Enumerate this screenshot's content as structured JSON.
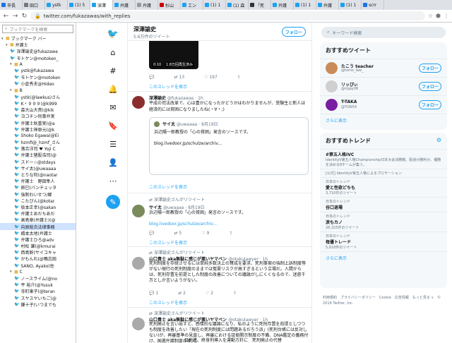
{
  "tabs": [
    {
      "label": "市長",
      "color": "#1a73e8"
    },
    {
      "label": "田口",
      "color": "#777"
    },
    {
      "label": "ystk",
      "color": "#1da1f2"
    },
    {
      "label": "(1) 5",
      "color": "#1da1f2"
    },
    {
      "label": "深澤",
      "color": "#1da1f2"
    },
    {
      "label": "弁護",
      "color": "#1da1f2"
    },
    {
      "label": "弁護",
      "color": "#999"
    },
    {
      "label": "杉山",
      "color": "#c00"
    },
    {
      "label": "エン",
      "color": "#1da1f2"
    },
    {
      "label": "(1) 1",
      "color": "#1da1f2"
    },
    {
      "label": "(1) 森",
      "color": "#1da1f2"
    },
    {
      "label": "「死",
      "color": "#333"
    },
    {
      "label": "弁護",
      "color": "#1da1f2"
    },
    {
      "label": "(1) 1",
      "color": "#1da1f2"
    },
    {
      "label": "弁護",
      "color": "#1da1f2"
    },
    {
      "label": "(1) 1",
      "color": "#1da1f2"
    },
    {
      "label": "scrr",
      "color": "#1a73e8"
    }
  ],
  "browser": {
    "url": "twitter.com/fukazawas/with_replies"
  },
  "sidebar": {
    "search_placeholder": "ブックマークを検索",
    "items": [
      {
        "label": "ブックマーク バー",
        "type": "folder",
        "level": 0
      },
      {
        "label": "弁護士",
        "type": "folder",
        "level": 1
      },
      {
        "label": "深澤諭史@fukazawa",
        "type": "bird",
        "level": 2
      },
      {
        "label": "モトケン@motoken_",
        "type": "bird",
        "level": 2
      },
      {
        "label": "A",
        "type": "folder",
        "level": 2
      },
      {
        "label": "ystk@fukazawa",
        "type": "bird",
        "level": 3
      },
      {
        "label": "モトケン@motoken",
        "type": "bird",
        "level": 3
      },
      {
        "label": "小倉秀夫@Hideo",
        "type": "bird",
        "level": 3
      },
      {
        "label": "B",
        "type": "folder",
        "level": 2
      },
      {
        "label": "ystk(@lawkus)さん",
        "type": "bird",
        "level": 3
      },
      {
        "label": "K・９９９(@k999",
        "type": "bird",
        "level": 3
      },
      {
        "label": "森大山大貴(@kik",
        "type": "bird",
        "level": 3
      },
      {
        "label": "ヨコチン刑事弁実",
        "type": "bird",
        "level": 3
      },
      {
        "label": "弁護士秋重実(@a",
        "type": "bird",
        "level": 3
      },
      {
        "label": "弁護士神原元(@k",
        "type": "bird",
        "level": 3
      },
      {
        "label": "Shoko Egawa(@Ei",
        "type": "bird",
        "level": 3
      },
      {
        "label": "hzmfi@_hzmf_さん",
        "type": "bird",
        "level": 3
      },
      {
        "label": "落合洋司 ♥ Yoji C",
        "type": "bird",
        "level": 3
      },
      {
        "label": "弁護士猪股浩司(@",
        "type": "bird",
        "level": 3
      },
      {
        "label": "スドー☆@stdays",
        "type": "bird",
        "level": 3
      },
      {
        "label": "サイ太(@uwaaaa",
        "type": "bird",
        "level": 3
      },
      {
        "label": "とりな利(@naotar",
        "type": "bird",
        "level": 3
      },
      {
        "label": "弁護士　野田隼人",
        "type": "bird",
        "level": 3
      },
      {
        "label": "辰巳(パンチェッタ",
        "type": "bird",
        "level": 3
      },
      {
        "label": "強制わいせつ/郷",
        "type": "bird",
        "level": 3
      },
      {
        "label": "こたぴん(@kotar",
        "type": "bird",
        "level": 3
      },
      {
        "label": "坂本正幸(@sakan",
        "type": "bird",
        "level": 3
      },
      {
        "label": "弁護士あだちあだ",
        "type": "bird",
        "level": 3
      },
      {
        "label": "高島章(弁護士)(@",
        "type": "bird",
        "level": 3
      },
      {
        "label": "向原総合法律事務",
        "type": "bird",
        "level": 3,
        "highlight": true
      },
      {
        "label": "橋本太地(弁護士",
        "type": "bird",
        "level": 3
      },
      {
        "label": "弁護士ひろ@adv",
        "type": "bird",
        "level": 3
      },
      {
        "label": "村松 謙(@kmurai",
        "type": "bird",
        "level": 3
      },
      {
        "label": "西島幹(サイコキャ",
        "type": "bird",
        "level": 3
      },
      {
        "label": "かもんれ(@鴨志田",
        "type": "bird",
        "level": 3
      },
      {
        "label": "SANO, Ayako(佐",
        "type": "bird",
        "level": 3
      },
      {
        "label": "C",
        "type": "folder",
        "level": 2
      },
      {
        "label": "ノースライム(@no",
        "type": "bird",
        "level": 3
      },
      {
        "label": "平 裕介(@Yusuk",
        "type": "bird",
        "level": 3
      },
      {
        "label": "寺町東子(@teran",
        "type": "bird",
        "level": 3
      },
      {
        "label": "スヤスヤいちご(@",
        "type": "bird",
        "level": 3
      },
      {
        "label": "鎌十子(いつまでも",
        "type": "bird",
        "level": 3
      }
    ]
  },
  "twitter_nav": [
    "twitter-logo-icon",
    "home-icon",
    "hash-icon",
    "bell-icon",
    "mail-icon",
    "bookmark-icon",
    "list-icon",
    "profile-icon",
    "more-icon",
    "compose-icon"
  ],
  "header": {
    "name": "深澤諭史",
    "sub": "5.6万件のツイート",
    "follow_label": "フォロー"
  },
  "video_tweet": {
    "time": "0:10",
    "views": "1.8万回再生済み",
    "retweets": "13",
    "likes": "197",
    "thread_link": "このスレッドを表示"
  },
  "tweet2": {
    "name": "深澤諭史",
    "handle": "@fukazawas · 1h",
    "text": "平成の司法改革で、心は豊かになったかどうかはわかりませんが、受験生と新人は経済的には貧困になりましたね(・∀・;)",
    "quote_name": "サイ太",
    "quote_handle": "@uwaaaa · 8月19日",
    "quote_text": "浜辺陽一郎教授の「心の貧困」発言のソースです。",
    "quote_link": "blog.livedoor.jp/schulze/archiv...",
    "thread_link": "このスレッドを表示"
  },
  "tweet3": {
    "rt_label": "深澤諭史さんがリツイート",
    "name": "サイ太",
    "handle": "@uwaaaa · 8月19日",
    "text": "浜辺陽一郎教授の「心の貧困」発言のソースです。",
    "link": "blog.livedoor.jp/schulze/archiv...",
    "retweets": "5",
    "likes": "9",
    "thread_link": "このスレッドを表示"
  },
  "tweet4": {
    "rt_label": "深澤諭史さんがリツイート",
    "name": "山口貴士 aka無駄に感じが悪いヤマベン",
    "handle": "@otakulawyer · 1h",
    "text": "死刑制度を存続させるには単純多数決上の賛成を要求、死刑事案の強制上訴制度等がない現行の死刑制度のままでは冤罪リスクが高すぎるという立場だ。人間から は、死刑存置を前提とした制度の改善についての議論がしにくくなるので、迷惑千万としか言いようがない。",
    "replies": "1",
    "retweets": "2",
    "likes": "2",
    "thread_link": "このスレッドを表示"
  },
  "tweet5": {
    "rt_label": "深澤諭史さんがリツイート",
    "name": "山口貴士 aka無駄に感じが悪いヤマベン",
    "handle": "@otakulawyer · 1h",
    "text": "死刑廃止を言い出すと、感情的な議論になり、私のように死刑存置を前提としつつも制度を改善したい「現在の死刑制度には問題あるだろう派」(死刑台帳には反対しない)が、再審基準の見直し、再審における証拠開示制度の不備、DNA鑑定の義務付け、国選弁護制度の導入。",
    "bottom_text": "日弁連、終身刑導入を運動方針に　死刑廃止の代替"
  },
  "right": {
    "search_placeholder": "キーワード検索",
    "recommend_title": "おすすめツイート",
    "follow_label": "フォロー",
    "users": [
      {
        "name": "たこう teacher",
        "handle": "@tomo_law_",
        "avatar_color": "#c98b5a"
      },
      {
        "name": "リッぴぃ",
        "handle": "@rippy08",
        "avatar_color": "#cfcfcf"
      },
      {
        "name": "T-TAKA",
        "handle": "@TGN54",
        "avatar_color": "#7a1fa2"
      }
    ],
    "more_label": "さらに表示",
    "trends_title": "おすすめトレンド",
    "trends": [
      {
        "cat": "",
        "name": "#第五人格IVC",
        "count": "IdentityV第五人格Championship日本大会決勝戦、阪道か勝利か、優勝を決める8チームが集う。"
      },
      {
        "cat": "",
        "name": "",
        "count": "[公式] IdentityV第五人格によるプロモーション"
      },
      {
        "cat": "日本のトレンド",
        "name": "愛と性欲どちも",
        "count": "3,710件のツイート"
      },
      {
        "cat": "日本のトレンド",
        "name": "谷口退場",
        "count": ""
      },
      {
        "cat": "日本のトレンド",
        "name": "涙もカノ",
        "count": "26,325件のツイート"
      },
      {
        "cat": "日本のトレンド",
        "name": "毎優トレード",
        "count": "5,818件のツイート"
      }
    ],
    "trends_more": "さらに表示",
    "footer": "利用規約　プライバシーポリシー　Cookie　広告情報　もっと見る ∨　© 2019 Twitter, Inc."
  }
}
